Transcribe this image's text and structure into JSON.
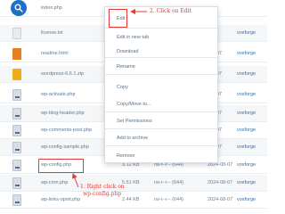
{
  "files": [
    {
      "name": "index.php",
      "icon": "php-file-icon",
      "size": "",
      "perms": "",
      "date": "",
      "owner": ""
    },
    {
      "name": "license.txt",
      "icon": "text-file-icon",
      "size": "",
      "perms": "",
      "date": "",
      "owner": "voxforge"
    },
    {
      "name": "readme.html",
      "icon": "html-file-icon",
      "size": "",
      "perms": "",
      "date": "-08-07",
      "owner": "voxforge"
    },
    {
      "name": "wordpress-6.6.1.zip",
      "icon": "zip-file-icon",
      "size": "",
      "perms": "",
      "date": "-08-07",
      "owner": "voxforge"
    },
    {
      "name": "wp-activate.php",
      "icon": "php-file-icon",
      "size": "",
      "perms": "",
      "date": "-08-07",
      "owner": "voxforge"
    },
    {
      "name": "wp-blog-header.php",
      "icon": "php-file-icon",
      "size": "",
      "perms": "",
      "date": "-08-07",
      "owner": "voxforge"
    },
    {
      "name": "wp-comments-post.php",
      "icon": "php-file-icon",
      "size": "",
      "perms": "",
      "date": "-08-07",
      "owner": "voxforge"
    },
    {
      "name": "wp-config-sample.php",
      "icon": "php-file-icon",
      "size": "",
      "perms": "",
      "date": "-08-07",
      "owner": "voxforge"
    },
    {
      "name": "wp-config.php",
      "icon": "php-file-icon",
      "size": "3.12 KB",
      "perms": "rw-r--r-- (644)",
      "date": "2024-08-07",
      "owner": "voxforge"
    },
    {
      "name": "wp-cron.php",
      "icon": "php-file-icon",
      "size": "5.51 KB",
      "perms": "rw-r--r-- (644)",
      "date": "2024-08-07",
      "owner": "voxforge"
    },
    {
      "name": "wp-links-opml.php",
      "icon": "php-file-icon",
      "size": "2.44 KB",
      "perms": "rw-r--r-- (644)",
      "date": "2024-08-07",
      "owner": "voxforge"
    }
  ],
  "context_menu": {
    "items": [
      {
        "label": "Edit"
      },
      {
        "label": "Edit in new tab"
      },
      {
        "label": "Download"
      },
      {
        "label": "Rename"
      },
      {
        "label": "Copy"
      },
      {
        "label": "Copy/Move to..."
      },
      {
        "label": "Set Permissions"
      },
      {
        "label": "Add to archive"
      },
      {
        "label": "Remove"
      }
    ]
  },
  "annotations": {
    "step1_line1": "1. Right click on",
    "step1_line2": "wp-config.php",
    "step2": "2. Click on Edit"
  },
  "colors": {
    "accent": "#1f6fc4",
    "annotation_red": "#e53935",
    "owner_link": "#2f6fb3"
  }
}
